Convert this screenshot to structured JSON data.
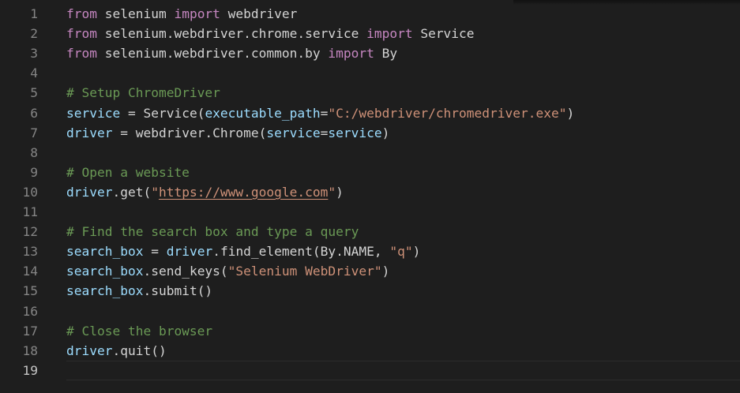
{
  "colors": {
    "background": "#1e1e1e",
    "line_number": "#858585",
    "line_number_active": "#c6c6c6",
    "keyword": "#c586c0",
    "identifier": "#d4d4d4",
    "variable": "#9cdcfe",
    "string": "#ce9178",
    "comment": "#6a9955"
  },
  "active_line": 19,
  "lines": [
    {
      "num": "1",
      "tokens": [
        {
          "t": "from",
          "c": "kw"
        },
        {
          "t": " selenium ",
          "c": "id"
        },
        {
          "t": "import",
          "c": "kw"
        },
        {
          "t": " webdriver",
          "c": "id"
        }
      ]
    },
    {
      "num": "2",
      "tokens": [
        {
          "t": "from",
          "c": "kw"
        },
        {
          "t": " selenium.webdriver.chrome.service ",
          "c": "id"
        },
        {
          "t": "import",
          "c": "kw"
        },
        {
          "t": " Service",
          "c": "id"
        }
      ]
    },
    {
      "num": "3",
      "tokens": [
        {
          "t": "from",
          "c": "kw"
        },
        {
          "t": " selenium.webdriver.common.by ",
          "c": "id"
        },
        {
          "t": "import",
          "c": "kw"
        },
        {
          "t": " By",
          "c": "id"
        }
      ]
    },
    {
      "num": "4",
      "tokens": []
    },
    {
      "num": "5",
      "tokens": [
        {
          "t": "# Setup ChromeDriver",
          "c": "cmt"
        }
      ]
    },
    {
      "num": "6",
      "tokens": [
        {
          "t": "service",
          "c": "var"
        },
        {
          "t": " = Service(",
          "c": "id"
        },
        {
          "t": "executable_path",
          "c": "var"
        },
        {
          "t": "=",
          "c": "id"
        },
        {
          "t": "\"C:/webdriver/chromedriver.exe\"",
          "c": "str"
        },
        {
          "t": ")",
          "c": "id"
        }
      ]
    },
    {
      "num": "7",
      "tokens": [
        {
          "t": "driver",
          "c": "var"
        },
        {
          "t": " = webdriver.Chrome(",
          "c": "id"
        },
        {
          "t": "service",
          "c": "var"
        },
        {
          "t": "=",
          "c": "id"
        },
        {
          "t": "service",
          "c": "var"
        },
        {
          "t": ")",
          "c": "id"
        }
      ]
    },
    {
      "num": "8",
      "tokens": []
    },
    {
      "num": "9",
      "tokens": [
        {
          "t": "# Open a website",
          "c": "cmt"
        }
      ]
    },
    {
      "num": "10",
      "tokens": [
        {
          "t": "driver",
          "c": "var"
        },
        {
          "t": ".get(",
          "c": "id"
        },
        {
          "t": "\"",
          "c": "str"
        },
        {
          "t": "https://www.google.com",
          "c": "str url"
        },
        {
          "t": "\"",
          "c": "str"
        },
        {
          "t": ")",
          "c": "id"
        }
      ]
    },
    {
      "num": "11",
      "tokens": []
    },
    {
      "num": "12",
      "tokens": [
        {
          "t": "# Find the search box and type a query",
          "c": "cmt"
        }
      ]
    },
    {
      "num": "13",
      "tokens": [
        {
          "t": "search_box",
          "c": "var"
        },
        {
          "t": " = ",
          "c": "id"
        },
        {
          "t": "driver",
          "c": "var"
        },
        {
          "t": ".find_element(By.NAME, ",
          "c": "id"
        },
        {
          "t": "\"q\"",
          "c": "str"
        },
        {
          "t": ")",
          "c": "id"
        }
      ]
    },
    {
      "num": "14",
      "tokens": [
        {
          "t": "search_box",
          "c": "var"
        },
        {
          "t": ".send_keys(",
          "c": "id"
        },
        {
          "t": "\"Selenium WebDriver\"",
          "c": "str"
        },
        {
          "t": ")",
          "c": "id"
        }
      ]
    },
    {
      "num": "15",
      "tokens": [
        {
          "t": "search_box",
          "c": "var"
        },
        {
          "t": ".submit()",
          "c": "id"
        }
      ]
    },
    {
      "num": "16",
      "tokens": []
    },
    {
      "num": "17",
      "tokens": [
        {
          "t": "# Close the browser",
          "c": "cmt"
        }
      ]
    },
    {
      "num": "18",
      "tokens": [
        {
          "t": "driver",
          "c": "var"
        },
        {
          "t": ".quit()",
          "c": "id"
        }
      ]
    },
    {
      "num": "19",
      "tokens": []
    }
  ]
}
